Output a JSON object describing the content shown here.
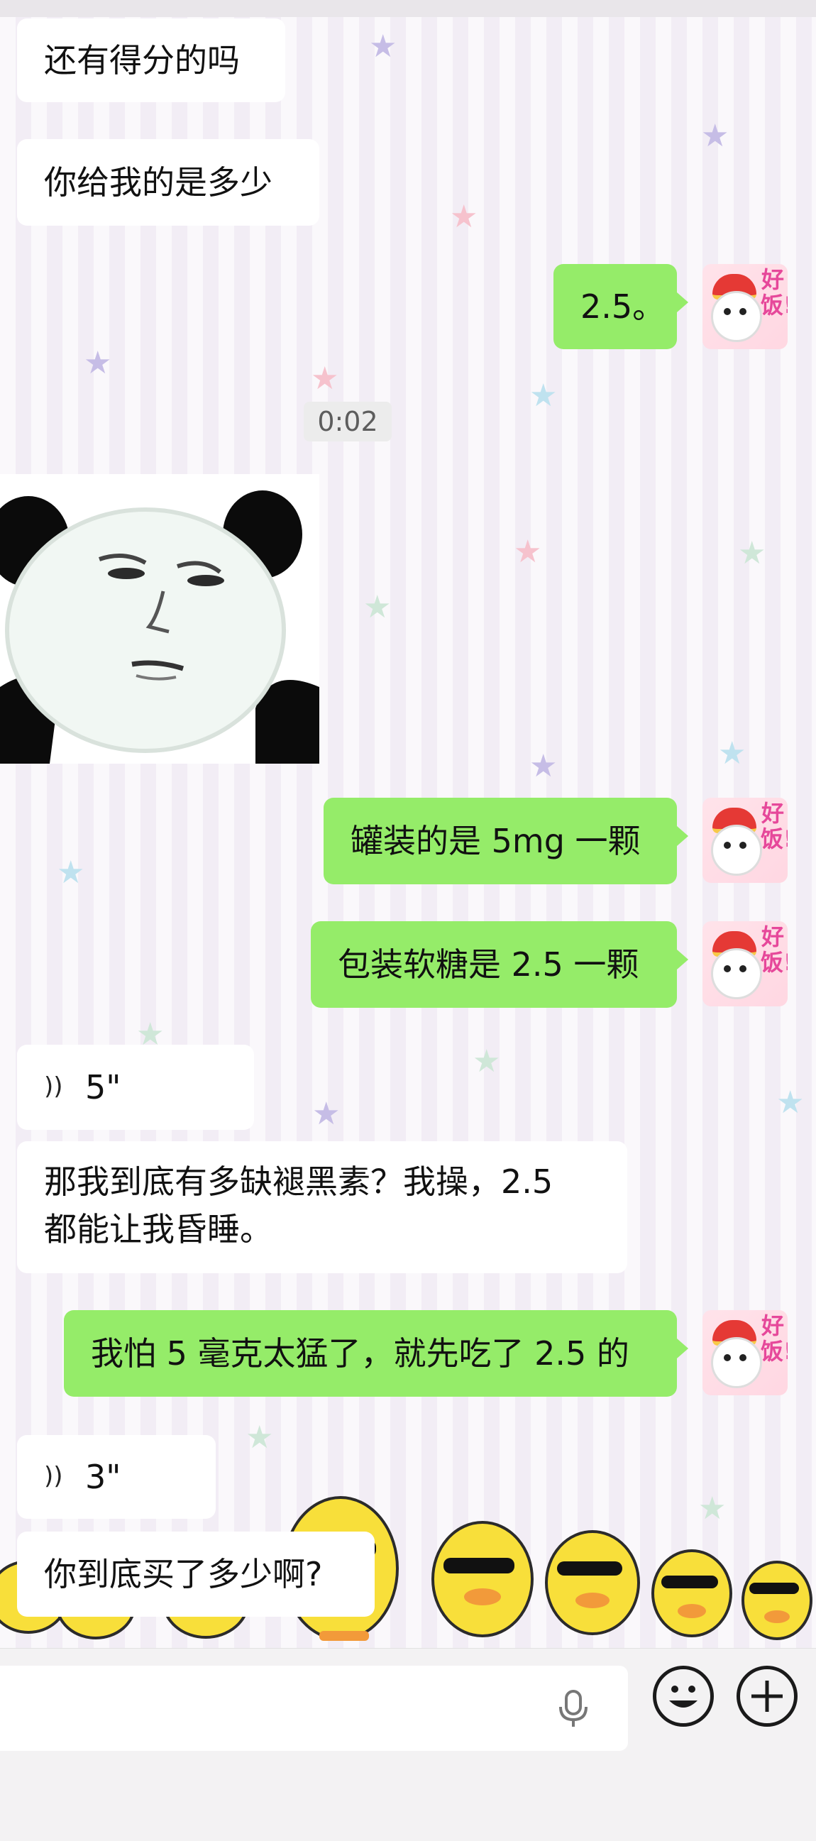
{
  "messages": [
    {
      "side": "in",
      "kind": "text",
      "text": "还有得分的吗"
    },
    {
      "side": "in",
      "kind": "text",
      "text": "你给我的是多少"
    },
    {
      "side": "out",
      "kind": "text",
      "text": "2.5。"
    },
    {
      "kind": "timestamp",
      "text": "0:02"
    },
    {
      "side": "in",
      "kind": "sticker",
      "sticker": "panda-meme-face"
    },
    {
      "side": "out",
      "kind": "text",
      "text": "罐装的是 5mg 一颗"
    },
    {
      "side": "out",
      "kind": "text",
      "text": "包装软糖是 2.5 一颗"
    },
    {
      "side": "in",
      "kind": "voice",
      "duration": "5\""
    },
    {
      "side": "in",
      "kind": "text",
      "lines": [
        "那我到底有多缺褪黑素？我操，2.5",
        "都能让我昏睡。"
      ]
    },
    {
      "side": "out",
      "kind": "text",
      "text": "我怕 5 毫克太猛了，就先吃了 2.5 的"
    },
    {
      "side": "in",
      "kind": "voice",
      "duration": "3\""
    },
    {
      "side": "in",
      "kind": "text",
      "text": "你到底买了多少啊?"
    }
  ],
  "avatar": {
    "label": "好饭!",
    "icon": "chef-avatar-icon"
  },
  "input_bar": {
    "icons": [
      "microphone-icon",
      "emoji-icon",
      "plus-icon"
    ]
  },
  "colors": {
    "outgoing_bubble": "#95ec69",
    "incoming_bubble": "#ffffff",
    "avatar_text": "#e6489a"
  }
}
